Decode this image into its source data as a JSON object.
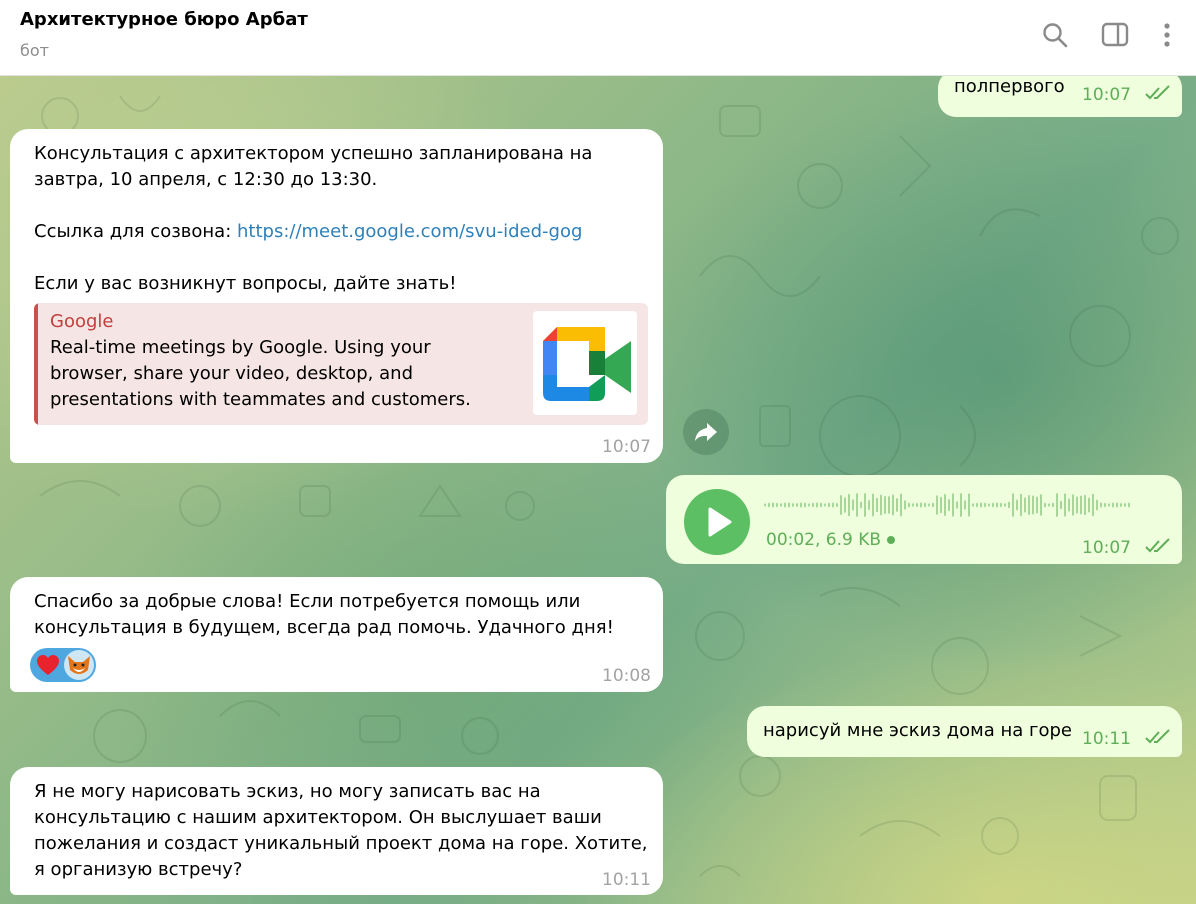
{
  "header": {
    "title": "Архитектурное бюро Арбат",
    "subtitle": "бот"
  },
  "messages": {
    "m1": {
      "text": "полпервого",
      "time": "10:07"
    },
    "m2": {
      "text_line1": "Консультация с архитектором успешно запланирована на",
      "text_line2": "завтра, 10 апреля, с 12:30 до 13:30.",
      "link_prefix": "Ссылка для созвона: ",
      "link": "https://meet.google.com/svu-ided-gog",
      "text_line3": "Если у вас возникнут вопросы, дайте знать!",
      "preview_site": "Google",
      "preview_desc": "Real-time meetings by Google. Using your browser, share your video, desktop, and presentations with teammates and customers.",
      "time": "10:07"
    },
    "m3": {
      "voice_meta": "00:02, 6.9 KB",
      "time": "10:07"
    },
    "m4": {
      "text": "Спасибо за добрые слова! Если потребуется помощь или консультация в будущем, всегда рад помочь. Удачного дня!",
      "reactions": [
        "heart",
        "fox-avatar"
      ],
      "time": "10:08"
    },
    "m5": {
      "text": "нарисуй мне эскиз дома на горе",
      "time": "10:11"
    },
    "m6": {
      "text": "Я не могу нарисовать эскиз, но могу записать вас на консультацию с нашим архитектором. Он выслушает ваши пожелания и создаст уникальный проект дома на горе. Хотите, я организую встречу?",
      "time": "10:11"
    }
  },
  "colors": {
    "outgoing_bubble": "#effedd",
    "incoming_bubble": "#ffffff",
    "accent_green": "#5cbf63",
    "link": "#2f80b8",
    "preview_accent": "#c8504d"
  },
  "icons": [
    "search-icon",
    "sidebar-toggle-icon",
    "more-vertical-icon",
    "forward-icon",
    "play-icon",
    "read-ticks-icon",
    "google-meet-logo"
  ]
}
